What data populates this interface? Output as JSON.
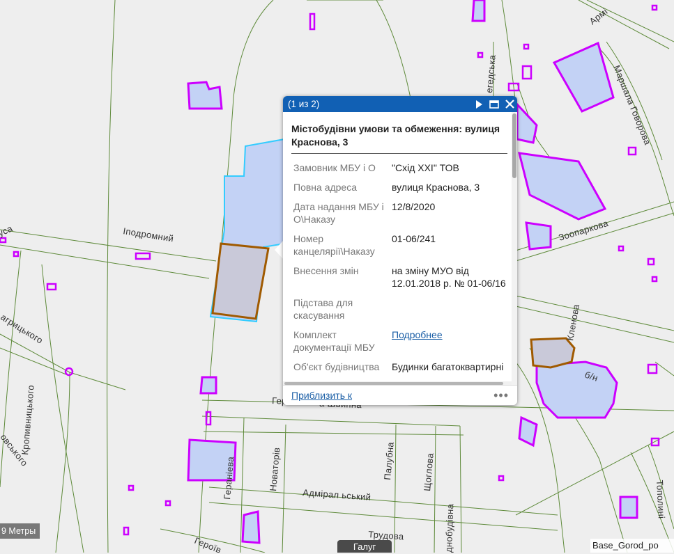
{
  "map": {
    "streets": {
      "ipodromnyi": "Іподромний",
      "marshala_govorova": "Маршала Говорова",
      "zooparkova": "Зоопаркова",
      "arm": "Армі",
      "klenova": "Кленова",
      "bn": "б/н",
      "heranieva": "Гераніева",
      "novatoriv": "Новаторів",
      "palubna": "Палубна",
      "shchohlova": "Щоглова",
      "admiralskyi": "Адмірал ьський",
      "trudova": "Трудова",
      "dnobudivna": "днобудівна",
      "heroi": "Героїв",
      "herasyma": "Гер…",
      "sh_vypna": "а Швипна",
      "kropyvnytskoho": "Кропивницького",
      "zahrytskoho": "агрицького",
      "ovskoho": "овського",
      "usa": "уса",
      "topolyni": "Тополині",
      "ehedska": "егедська",
      "slova": "кова"
    },
    "colors": {
      "parcel_fill": "#c3d2f5",
      "parcel_outline": "#cc00ff",
      "selected_outline": "#33ccff",
      "highlight_outline": "#a05a00",
      "road": "#5e8a3a",
      "background": "#eeeeee"
    }
  },
  "popup": {
    "count": "(1 из 2)",
    "title": "Містобудівни умови та обмеження: вулиця Краснова, 3",
    "fields": [
      {
        "key": "Замовник МБУ і О",
        "value": "\"Схід XXI\" ТОВ"
      },
      {
        "key": "Повна адреса",
        "value": "вулиця Краснова, 3"
      },
      {
        "key": "Дата надання МБУ і О\\Наказу",
        "value": "12/8/2020"
      },
      {
        "key": "Номер канцелярії\\Наказу",
        "value": "01-06/241"
      },
      {
        "key": "Внесення змін",
        "value": "на зміну МУО від 12.01.2018 р. № 01-06/16"
      },
      {
        "key": "Підстава для скасування",
        "value": ""
      },
      {
        "key": "Комплект документації МБУ",
        "value": "Подробнее",
        "link": true
      },
      {
        "key": "Об'єкт будівництва",
        "value": "Будинки багатоквартирні"
      }
    ],
    "zoom_link": "Приблизить к",
    "more": "•••",
    "icons": {
      "next": "play-icon",
      "maximize": "maximize-icon",
      "close": "close-icon"
    }
  },
  "scalebar": {
    "label": "9 Метры"
  },
  "attribution": {
    "text": "Base_Gorod_po"
  },
  "partial_button": {
    "label": "Галуг"
  }
}
